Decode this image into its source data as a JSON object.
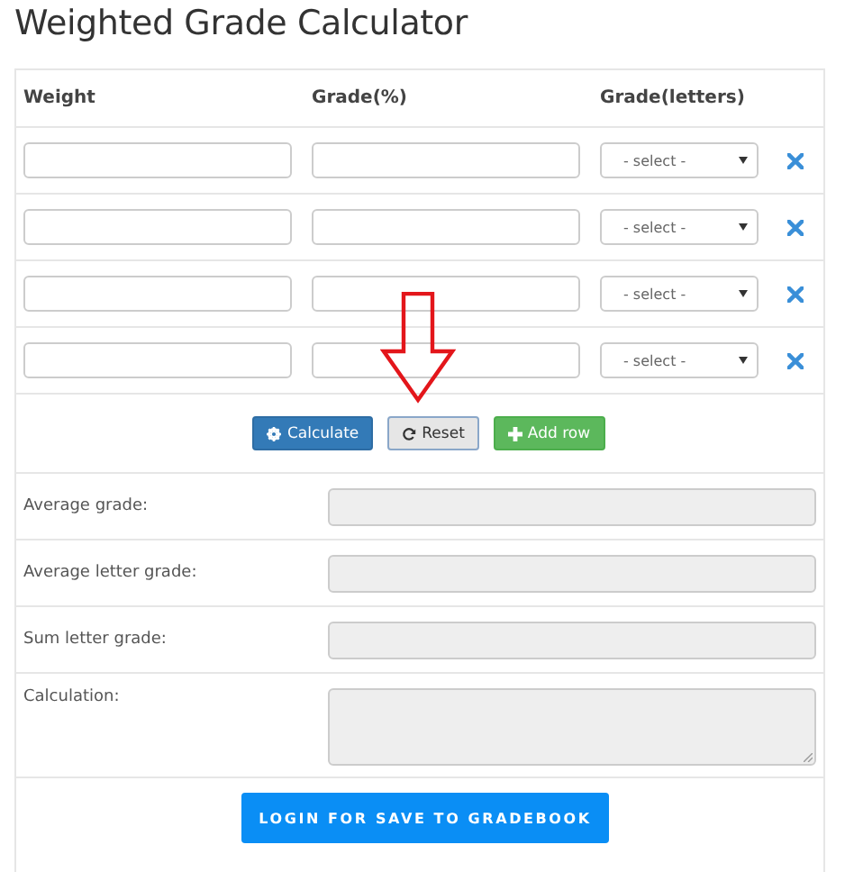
{
  "title": "Weighted Grade Calculator",
  "columns": [
    "Weight",
    "Grade(%)",
    "Grade(letters)"
  ],
  "rows": [
    {
      "weight": "",
      "grade": "",
      "letter": "- select -"
    },
    {
      "weight": "",
      "grade": "",
      "letter": "- select -"
    },
    {
      "weight": "",
      "grade": "",
      "letter": "- select -"
    },
    {
      "weight": "",
      "grade": "",
      "letter": "- select -"
    }
  ],
  "buttons": [
    {
      "kind": "calculate",
      "label": "Calculate"
    },
    {
      "kind": "reset",
      "label": "Reset"
    },
    {
      "kind": "add",
      "label": "Add row"
    }
  ],
  "results": [
    {
      "label": "Average grade:",
      "kind": "line"
    },
    {
      "label": "Average letter grade:",
      "kind": "line"
    },
    {
      "label": "Sum letter grade:",
      "kind": "line"
    },
    {
      "label": "Calculation:",
      "kind": "area"
    }
  ],
  "save_button": "LOGIN FOR SAVE TO GRADEBOOK"
}
